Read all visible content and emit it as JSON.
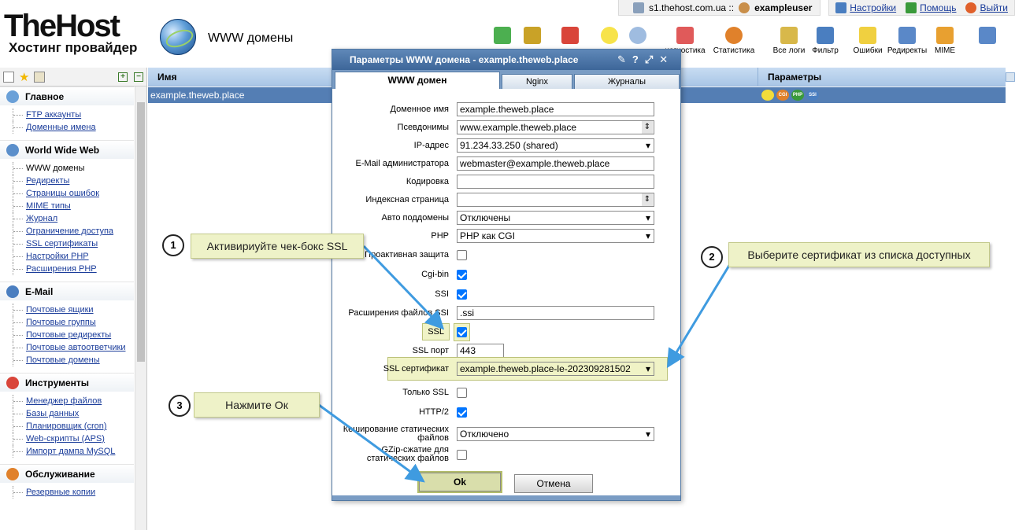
{
  "topbar": {
    "server": "s1.thehost.com.ua ::",
    "user": "exampleuser",
    "settings": "Настройки",
    "help": "Помощь",
    "logout": "Выйти"
  },
  "header": {
    "logo_main": "TheHost",
    "logo_sub": "Хостинг провайдер",
    "page_title": "WWW домены"
  },
  "toolbar": [
    {
      "label": "",
      "icon": "add-icon",
      "color": "#4caf50"
    },
    {
      "label": "",
      "icon": "edit-icon",
      "color": "#c9a227"
    },
    {
      "label": "",
      "icon": "delete-icon",
      "color": "#d9453a"
    },
    {
      "label": "",
      "icon": "bulb-on-icon",
      "color": "#f7e34a"
    },
    {
      "label": "",
      "icon": "bulb-off-icon",
      "color": "#9fbce0"
    },
    {
      "label": "иагностика",
      "icon": "diagnostics-icon",
      "color": "#e05a5a"
    },
    {
      "label": "Статистика",
      "icon": "pie-chart-icon",
      "color": "#e0812b"
    },
    {
      "label": "Все логи",
      "icon": "logs-icon",
      "color": "#d8b84a"
    },
    {
      "label": "Фильтр",
      "icon": "filter-icon",
      "color": "#4a7ec0"
    },
    {
      "label": "Ошибки",
      "icon": "warning-icon",
      "color": "#f0d040"
    },
    {
      "label": "Редиректы",
      "icon": "redirect-icon",
      "color": "#5a88c8"
    },
    {
      "label": "MIME",
      "icon": "mime-icon",
      "color": "#e8a030"
    },
    {
      "label": "",
      "icon": "exit-icon",
      "color": "#5a88c8"
    }
  ],
  "sidebar": {
    "groups": [
      {
        "title": "Главное",
        "color": "#6aa0d8",
        "items": [
          "FTP аккаунты",
          "Доменные имена"
        ]
      },
      {
        "title": "World Wide Web",
        "color": "#5b8fcb",
        "items": [
          "WWW домены",
          "Редиректы",
          "Страницы ошибок",
          "MIME типы",
          "Журнал",
          "Ограничение доступа",
          "SSL сертификаты",
          "Настройки PHP",
          "Расширения PHP"
        ]
      },
      {
        "title": "E-Mail",
        "color": "#4a7ec0",
        "items": [
          "Почтовые ящики",
          "Почтовые группы",
          "Почтовые редиректы",
          "Почтовые автоответчики",
          "Почтовые домены"
        ]
      },
      {
        "title": "Инструменты",
        "color": "#d9453a",
        "items": [
          "Менеджер файлов",
          "Базы данных",
          "Планировщик (cron)",
          "Web-скрипты (APS)",
          "Импорт дампа MySQL"
        ]
      },
      {
        "title": "Обслуживание",
        "color": "#e0812b",
        "items": [
          "Резервные копии"
        ]
      }
    ]
  },
  "table": {
    "col_name": "Имя",
    "col_params": "Параметры",
    "row_name": "example.theweb.place",
    "flags": [
      {
        "text": "",
        "color": "#f2dc3a"
      },
      {
        "text": "CGI",
        "color": "#e0812b"
      },
      {
        "text": "PHP",
        "color": "#3a9a3a"
      },
      {
        "text": "SSI",
        "color": "#4a7ec0"
      }
    ]
  },
  "dialog": {
    "title": "Параметры WWW домена - example.theweb.place",
    "tabs": [
      "WWW домен",
      "Nginx",
      "Журналы"
    ],
    "fields": {
      "domain_label": "Доменное имя",
      "domain_value": "example.theweb.place",
      "aliases_label": "Псевдонимы",
      "aliases_value": "www.example.theweb.place",
      "ip_label": "IP-адрес",
      "ip_value": "91.234.33.250 (shared)",
      "email_label": "E-Mail администратора",
      "email_value": "webmaster@example.theweb.place",
      "charset_label": "Кодировка",
      "charset_value": "",
      "index_label": "Индексная страница",
      "index_value": "",
      "autosub_label": "Авто поддомены",
      "autosub_value": "Отключены",
      "php_label": "PHP",
      "php_value": "PHP как CGI",
      "proactive_label": "Проактивная защита",
      "cgi_label": "Cgi-bin",
      "ssi_label": "SSI",
      "ssi_ext_label": "Расширения файлов SSI",
      "ssi_ext_value": ".ssi",
      "ssl_label": "SSL",
      "ssl_port_label": "SSL порт",
      "ssl_port_value": "443",
      "ssl_cert_label": "SSL сертификат",
      "ssl_cert_value": "example.theweb.place-le-202309281502",
      "only_ssl_label": "Только SSL",
      "http2_label": "HTTP/2",
      "cache_label": "Кеширование статических файлов",
      "cache_value": "Отключено",
      "gzip_label": "GZip-сжатие для статических файлов"
    },
    "ok": "Ok",
    "cancel": "Отмена"
  },
  "callouts": [
    {
      "num": "1",
      "text": "Активириуйте чек-бокс SSL"
    },
    {
      "num": "2",
      "text": "Выберите сертификат из списка доступных"
    },
    {
      "num": "3",
      "text": "Нажмите Ок"
    }
  ]
}
